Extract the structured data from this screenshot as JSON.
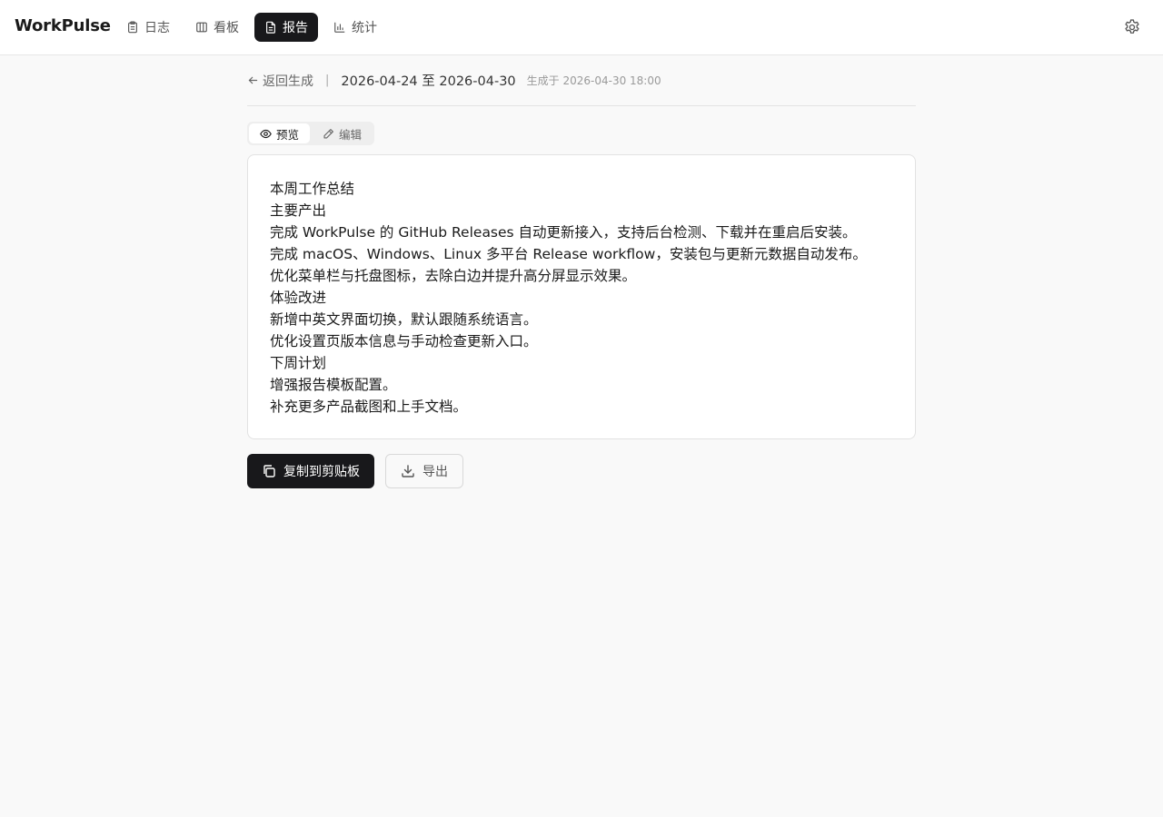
{
  "app": {
    "title": "WorkPulse"
  },
  "nav": {
    "items": [
      {
        "label": "日志",
        "icon": "clipboard-icon",
        "active": false
      },
      {
        "label": "看板",
        "icon": "columns-icon",
        "active": false
      },
      {
        "label": "报告",
        "icon": "file-text-icon",
        "active": true
      },
      {
        "label": "统计",
        "icon": "bar-chart-icon",
        "active": false
      }
    ],
    "settings_icon": "gear-icon"
  },
  "report": {
    "back_label": "返回生成",
    "separator": "|",
    "date_range": "2026-04-24 至 2026-04-30",
    "generated_at": "生成于 2026-04-30 18:00",
    "modes": {
      "preview": "预览",
      "edit": "编辑",
      "active": "preview"
    },
    "lines": [
      "本周工作总结",
      "主要产出",
      "完成 WorkPulse 的 GitHub Releases 自动更新接入，支持后台检测、下载并在重启后安装。",
      "完成 macOS、Windows、Linux 多平台 Release workflow，安装包与更新元数据自动发布。",
      "优化菜单栏与托盘图标，去除白边并提升高分屏显示效果。",
      "体验改进",
      "新增中英文界面切换，默认跟随系统语言。",
      "优化设置页版本信息与手动检查更新入口。",
      "下周计划",
      "增强报告模板配置。",
      "补充更多产品截图和上手文档。"
    ],
    "actions": {
      "copy": "复制到剪贴板",
      "export": "导出"
    }
  },
  "colors": {
    "accent": "#18181b",
    "background": "#f9f9f9",
    "card": "#ffffff"
  }
}
